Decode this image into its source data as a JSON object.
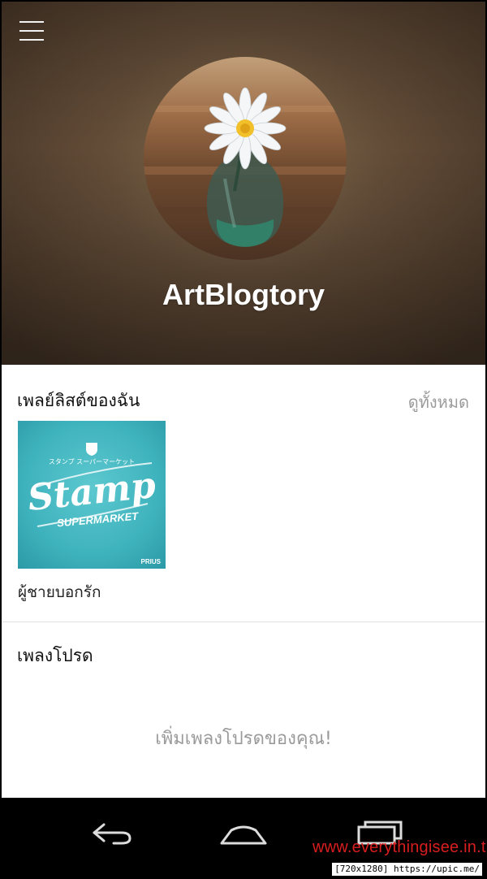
{
  "header": {
    "menu_icon": "hamburger-menu-icon",
    "avatar_image": "daisy-in-glass-vase",
    "profile_name": "ArtBlogtory"
  },
  "playlists": {
    "title": "เพลย์ลิสต์ของฉัน",
    "see_all": "ดูทั้งหมด",
    "items": [
      {
        "title": "ผู้ชายบอกรัก",
        "cover": {
          "small_text": "スタンプ スーパーマーケット",
          "main_text": "Stamp",
          "sub_text": "SUPERMARKET",
          "corner_text": "PRIUS",
          "bg_color": "#3fb3bd"
        }
      }
    ]
  },
  "favorites": {
    "title": "เพลงโปรด",
    "empty_message": "เพิ่มเพลงโปรดของคุณ!"
  },
  "navbar": {
    "back_icon": "back-icon",
    "home_icon": "home-icon",
    "recents_icon": "recent-apps-icon"
  },
  "overlay": {
    "watermark": "www.everythingisee.in.th",
    "url_badge": "[720x1280] https://upic.me/"
  }
}
